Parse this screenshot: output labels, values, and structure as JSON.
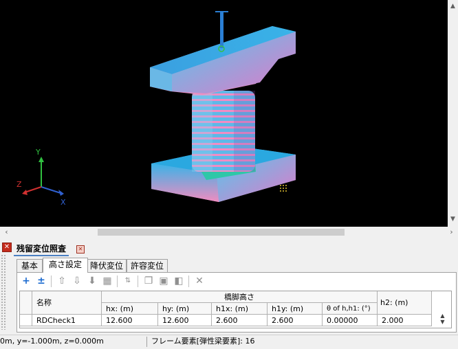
{
  "axes": {
    "x": "X",
    "y": "Y",
    "z": "Z"
  },
  "panel": {
    "title": "残留変位照査"
  },
  "tabs": [
    "基本",
    "高さ設定",
    "降伏変位",
    "許容変位"
  ],
  "toolbar": {
    "icons": [
      "add-icon",
      "add-row-icon",
      "move-up-icon",
      "move-down-icon",
      "move-bottom-icon",
      "grid-icon",
      "sort-icon",
      "copy-icon",
      "paste-icon",
      "paste-special-icon",
      "delete-icon"
    ]
  },
  "table": {
    "group_header": "橋脚高さ",
    "col_name": "名称",
    "cols": [
      "hx: (m)",
      "hy: (m)",
      "h1x: (m)",
      "h1y: (m)",
      "θ of h,h1: (°)",
      "h2: (m)"
    ],
    "row": {
      "name": "RDCheck1",
      "values": [
        "12.600",
        "12.600",
        "2.600",
        "2.600",
        "0.00000",
        "2.000"
      ]
    }
  },
  "status": {
    "coords": "0m, y=-1.000m, z=0.000m",
    "element": "フレーム要素[弾性梁要素]: 16"
  },
  "colors": {
    "viewport_bg": "#000000",
    "accent": "#4a7fc1"
  }
}
